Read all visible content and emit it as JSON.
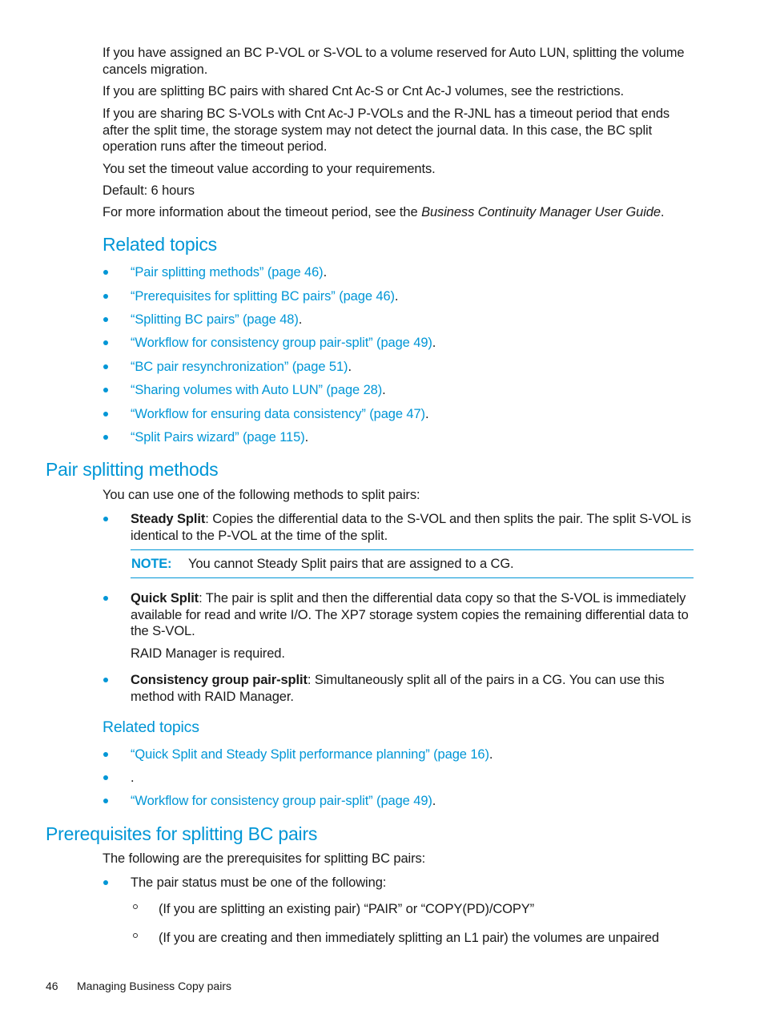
{
  "intro": {
    "paragraphs": [
      "If you have assigned an BC P-VOL or S-VOL to a volume reserved for Auto LUN, splitting the volume cancels migration.",
      "If you are splitting BC pairs with shared Cnt Ac-S or Cnt Ac-J volumes, see the restrictions.",
      "If you are sharing BC S-VOLs with Cnt Ac-J P-VOLs and the R-JNL has a timeout period that ends after the split time, the storage system may not detect the journal data. In this case, the BC split operation runs after the timeout period.",
      "You set the timeout value according to your requirements.",
      "Default: 6 hours"
    ],
    "more_info": {
      "prefix": "For more information about the timeout period, see the ",
      "italic": "Business Continuity Manager User Guide",
      "suffix": "."
    }
  },
  "related_topics_1": {
    "heading": "Related topics",
    "links": [
      "“Pair splitting methods” (page 46)",
      "“Prerequisites for splitting BC pairs” (page 46)",
      "“Splitting BC pairs” (page 48)",
      "“Workflow for consistency group pair-split” (page 49)",
      "“BC pair resynchronization” (page 51)",
      "“Sharing volumes with Auto LUN” (page 28)",
      "“Workflow for ensuring data consistency” (page 47)",
      "“Split Pairs wizard” (page 115)"
    ],
    "terminator": "."
  },
  "pair_splitting_methods": {
    "heading": "Pair splitting methods",
    "intro": "You can use one of the following methods to split pairs:",
    "methods": [
      {
        "term": "Steady Split",
        "text": ": Copies the differential data to the S-VOL and then splits the pair. The split S-VOL is identical to the P-VOL at the time of the split."
      },
      {
        "term": "Quick Split",
        "text": ": The pair is split and then the differential data copy so that the S-VOL is immediately available for read and write I/O. The XP7 storage system copies the remaining differential data to the S-VOL.",
        "extra": "RAID Manager is required."
      },
      {
        "term": "Consistency group pair-split",
        "text": ": Simultaneously split all of the pairs in a CG. You can use this method with RAID Manager."
      }
    ],
    "note": {
      "label": "NOTE:",
      "text": "You cannot Steady Split pairs that are assigned to a CG."
    }
  },
  "related_topics_2": {
    "heading": "Related topics",
    "links": [
      "“Quick Split and Steady Split performance planning” (page 16)",
      "",
      "“Workflow for consistency group pair-split” (page 49)"
    ],
    "terminator": "."
  },
  "prerequisites": {
    "heading": "Prerequisites for splitting BC pairs",
    "intro": "The following are the prerequisites for splitting BC pairs:",
    "bullet": "The pair status must be one of the following:",
    "sub_items": [
      "(If you are splitting an existing pair) “PAIR” or “COPY(PD)/COPY”",
      "(If you are creating and then immediately splitting an L1 pair) the volumes are unpaired"
    ]
  },
  "footer": {
    "page_number": "46",
    "chapter": "Managing Business Copy pairs"
  },
  "colors": {
    "accent": "#0096d6",
    "text": "#1a1a1a"
  }
}
